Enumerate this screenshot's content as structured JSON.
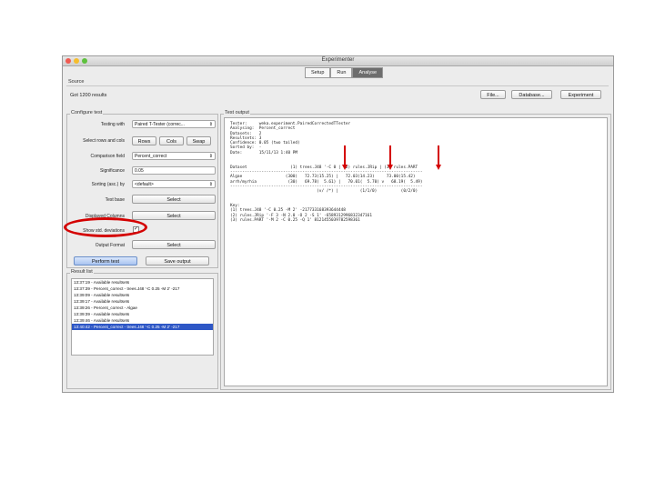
{
  "window": {
    "title": "Experimenter"
  },
  "tabs": [
    {
      "label": "Setup",
      "active": false
    },
    {
      "label": "Run",
      "active": false
    },
    {
      "label": "Analyse",
      "active": true
    }
  ],
  "source": {
    "label": "Source",
    "status": "Got 1200 results",
    "buttons": {
      "file": "File...",
      "database": "Database...",
      "experiment": "Experiment"
    }
  },
  "configure": {
    "title": "Configure test",
    "testing_with": {
      "label": "Testing with",
      "value": "Paired T-Tester (correc..."
    },
    "select_rows_cols": {
      "label": "Select rows and cols",
      "rows": "Rows",
      "cols": "Cols",
      "swap": "Swap"
    },
    "comparison_field": {
      "label": "Comparison field",
      "value": "Percent_correct"
    },
    "significance": {
      "label": "Significance",
      "value": "0.05"
    },
    "sorting": {
      "label": "Sorting (asc.) by",
      "value": "<default>"
    },
    "test_base": {
      "label": "Test base",
      "button": "Select"
    },
    "displayed_columns": {
      "label": "Displayed Columns",
      "button": "Select"
    },
    "show_std": {
      "label": "Show std. deviations",
      "checked": true,
      "mark": "✓"
    },
    "output_format": {
      "label": "Output Format",
      "button": "Select"
    },
    "perform_test": "Perform test",
    "save_output": "Save output"
  },
  "result_list": {
    "title": "Result list",
    "items": [
      {
        "text": "13:37:19 - Available resultsets",
        "selected": false
      },
      {
        "text": "13:37:39 - Percent_correct - trees.J48 '-C 0.25 -M 2' -217",
        "selected": false
      },
      {
        "text": "13:39:09 - Available resultsets",
        "selected": false
      },
      {
        "text": "13:39:17 - Available resultsets",
        "selected": false
      },
      {
        "text": "13:39:26 - Percent_correct - Algae",
        "selected": false
      },
      {
        "text": "13:39:39 - Available resultsets",
        "selected": false
      },
      {
        "text": "13:39:46 - Available resultsets",
        "selected": false
      },
      {
        "text": "13:40:42 - Percent_correct - trees.J48 '-C 0.25 -M 2' -217",
        "selected": true
      }
    ]
  },
  "test_output": {
    "title": "Test output",
    "text": "Tester:     weka.experiment.PairedCorrectedTTester\nAnalysing:  Percent_correct\nDatasets:   2\nResultsets: 3\nConfidence: 0.05 (two tailed)\nSorted by:  -\nDate:       15/11/13 1:40 PM\n\n\nDataset                  (1) trees.J48 '-C 0 | (2) rules.JRip | (3) rules.PART\n--------------------------------------------------------------------------------\nAlgae                  (300)   72.73(15.25) |   72.03(14.23)     73.00(15.42)\narrh/myrhia             (30)   69.78(  5.61) |   70.01(  5.70) v   68.19(  5.49)\n--------------------------------------------------------------------------------\n                                    (v/ /*) |         (1/1/0)          (0/2/0)\n\n\nKey:\n(1) trees.J48 '-C 0.25 -M 2' -217733168393644448\n(2) rules.JRip '-F 3 -N 2.0 -O 2 -S 1' -6589312996832347161\n(3) rules.PART '-M 2 -C 0.25 -Q 1' 8121455039782598361"
  },
  "colors": {
    "annotation": "#d40000",
    "selection": "#2e57c6",
    "active_tab": "#6d6d6d"
  }
}
